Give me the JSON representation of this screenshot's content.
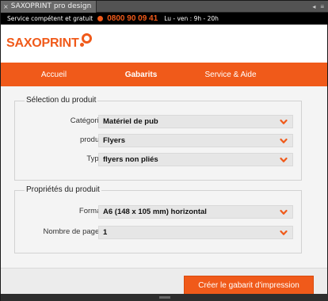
{
  "panel": {
    "title": "SAXOPRINT pro design",
    "close_glyph": "×",
    "menu_glyphs": [
      "◂",
      "≡"
    ]
  },
  "info_bar": {
    "service": "Service compétent et gratuit",
    "phone": "0800 90 09 41",
    "hours": "Lu - ven : 9h - 20h"
  },
  "brand": {
    "name": "SAXOPRINT",
    "accent": "#f05a1a"
  },
  "nav": {
    "items": [
      "Accueil",
      "Gabarits",
      "Service & Aide"
    ],
    "active": "Gabarits"
  },
  "product_selection": {
    "title": "Sélection du produit",
    "fields": [
      {
        "label": "Catégorie",
        "value": "Matériel de pub"
      },
      {
        "label": "produit",
        "value": "Flyers"
      },
      {
        "label": "Type",
        "value": "flyers non pliés"
      }
    ]
  },
  "product_properties": {
    "title": "Propriétés du produit",
    "fields": [
      {
        "label": "Format",
        "value": "A6 (148 x 105 mm) horizontal"
      },
      {
        "label": "Nombre de pages",
        "value": "1"
      }
    ]
  },
  "footer": {
    "create_label": "Créer le gabarit d'impression"
  },
  "icons": {
    "dropdown": "chevron-down-icon",
    "phone": "phone-icon"
  }
}
